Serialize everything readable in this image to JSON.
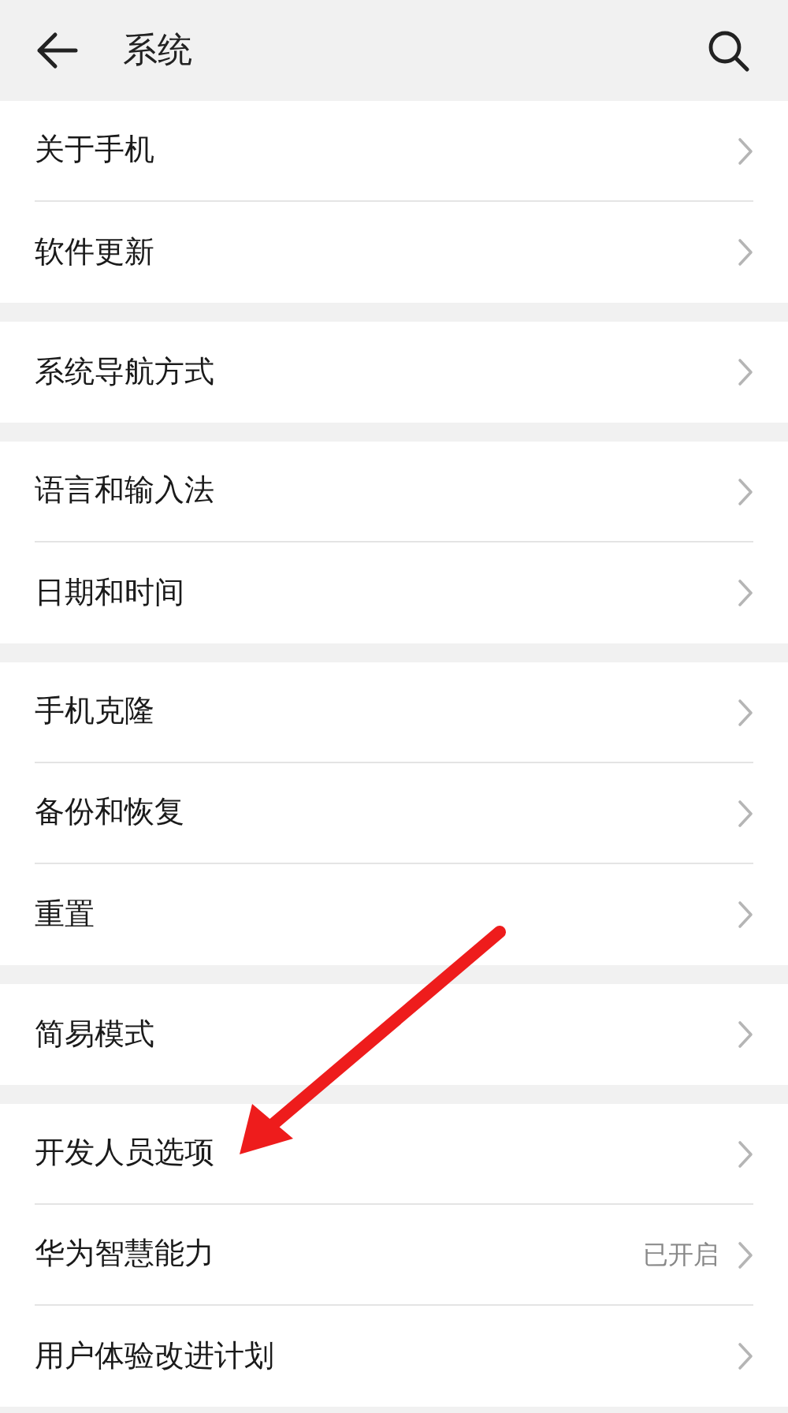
{
  "header": {
    "title": "系统"
  },
  "groups": [
    [
      {
        "label": "关于手机"
      },
      {
        "label": "软件更新"
      }
    ],
    [
      {
        "label": "系统导航方式"
      }
    ],
    [
      {
        "label": "语言和输入法"
      },
      {
        "label": "日期和时间"
      }
    ],
    [
      {
        "label": "手机克隆"
      },
      {
        "label": "备份和恢复"
      },
      {
        "label": "重置"
      }
    ],
    [
      {
        "label": "简易模式"
      }
    ],
    [
      {
        "label": "开发人员选项"
      },
      {
        "label": "华为智慧能力",
        "value": "已开启"
      },
      {
        "label": "用户体验改进计划"
      }
    ]
  ]
}
